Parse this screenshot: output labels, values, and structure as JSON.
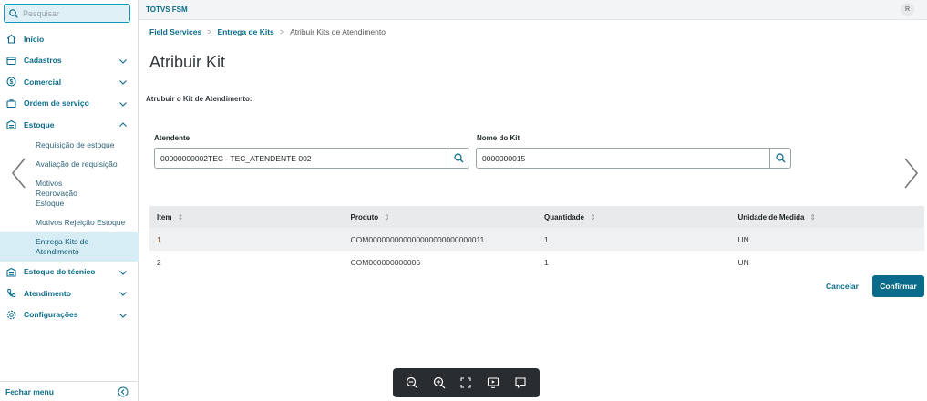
{
  "search": {
    "placeholder": "Pesquisar"
  },
  "sidebar": {
    "items": [
      {
        "label": "Início"
      },
      {
        "label": "Cadastros"
      },
      {
        "label": "Comercial"
      },
      {
        "label": "Ordem de serviço"
      },
      {
        "label": "Estoque"
      }
    ],
    "estoque_sub": [
      {
        "label": "Requisição de estoque"
      },
      {
        "label": "Avaliação de requisição"
      },
      {
        "label": "Motivos Reprovação Estoque"
      },
      {
        "label": "Motivos Rejeição Estoque"
      },
      {
        "label": "Entrega Kits de Atendimento"
      }
    ],
    "items_after": [
      {
        "label": "Estoque do técnico"
      },
      {
        "label": "Atendimento"
      },
      {
        "label": "Configurações"
      }
    ],
    "footer_label": "Fechar menu"
  },
  "header": {
    "app_title": "TOTVS FSM",
    "avatar_initial": "R"
  },
  "breadcrumb": {
    "items": [
      "Field Services",
      "Entrega de Kits",
      "Atribuir Kits de Atendimento"
    ],
    "separator": ">"
  },
  "page": {
    "title": "Atribuir Kit",
    "section_label": "Atrubuir o Kit de Atendimento:"
  },
  "form": {
    "atendente": {
      "label": "Atendente",
      "value": "00000000002TEC - TEC_ATENDENTE 002"
    },
    "nome_kit": {
      "label": "Nome do Kit",
      "value": "0000000015"
    }
  },
  "table": {
    "columns": [
      "Item",
      "Produto",
      "Quantidade",
      "Unidade de Medida"
    ],
    "sort_glyph": "⇕",
    "rows": [
      {
        "item": "1",
        "produto": "COM000000000000000000000000011",
        "quantidade": "1",
        "unidade": "UN"
      },
      {
        "item": "2",
        "produto": "COM000000000006",
        "quantidade": "1",
        "unidade": "UN"
      }
    ]
  },
  "actions": {
    "cancel_label": "Cancelar",
    "confirm_label": "Confirmar"
  },
  "colors": {
    "accent": "#0a6b8a",
    "active_bg": "#d7edf5",
    "toolbar_bg": "#2a2d30"
  },
  "icons": {
    "menu": [
      "home-icon",
      "register-icon",
      "dollar-icon",
      "work-order-icon",
      "warehouse-icon",
      "warehouse-icon",
      "phone-icon",
      "gear-icon"
    ],
    "viewer_toolbar": [
      "zoom-out-icon",
      "zoom-in-icon",
      "fit-screen-icon",
      "presentation-icon",
      "comment-icon"
    ]
  }
}
